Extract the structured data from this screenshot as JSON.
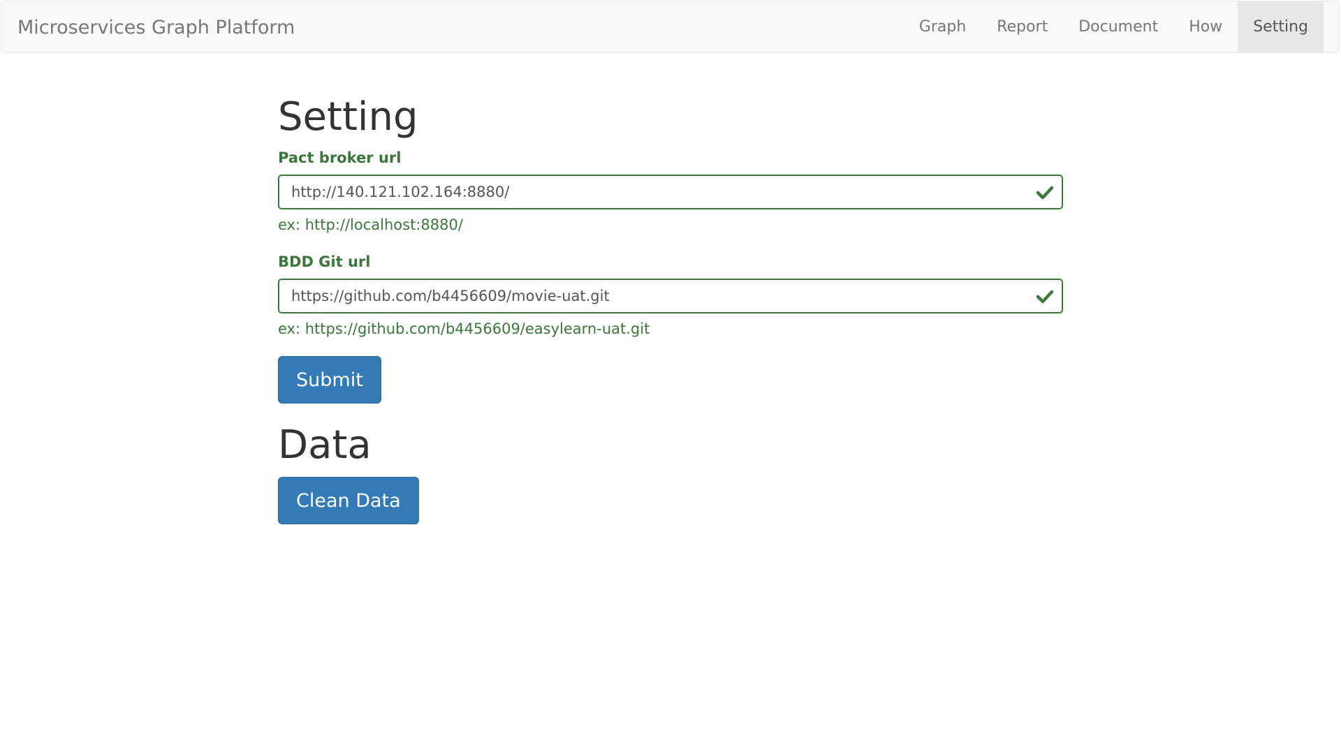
{
  "navbar": {
    "brand": "Microservices Graph Platform",
    "items": [
      {
        "label": "Graph",
        "active": false
      },
      {
        "label": "Report",
        "active": false
      },
      {
        "label": "Document",
        "active": false
      },
      {
        "label": "How",
        "active": false
      },
      {
        "label": "Setting",
        "active": true
      }
    ]
  },
  "setting": {
    "title": "Setting",
    "pact_broker": {
      "label": "Pact broker url",
      "value": "http://140.121.102.164:8880/",
      "help": "ex: http://localhost:8880/",
      "status_icon": "check-icon"
    },
    "bdd_git": {
      "label": "BDD Git url",
      "value": "https://github.com/b4456609/movie-uat.git",
      "help": "ex: https://github.com/b4456609/easylearn-uat.git",
      "status_icon": "check-icon"
    },
    "submit_label": "Submit"
  },
  "data_section": {
    "title": "Data",
    "clean_label": "Clean Data"
  },
  "colors": {
    "success": "#3c763d",
    "primary": "#337ab7",
    "navbar_bg": "#f8f8f8",
    "nav_active_bg": "#e7e7e7"
  }
}
